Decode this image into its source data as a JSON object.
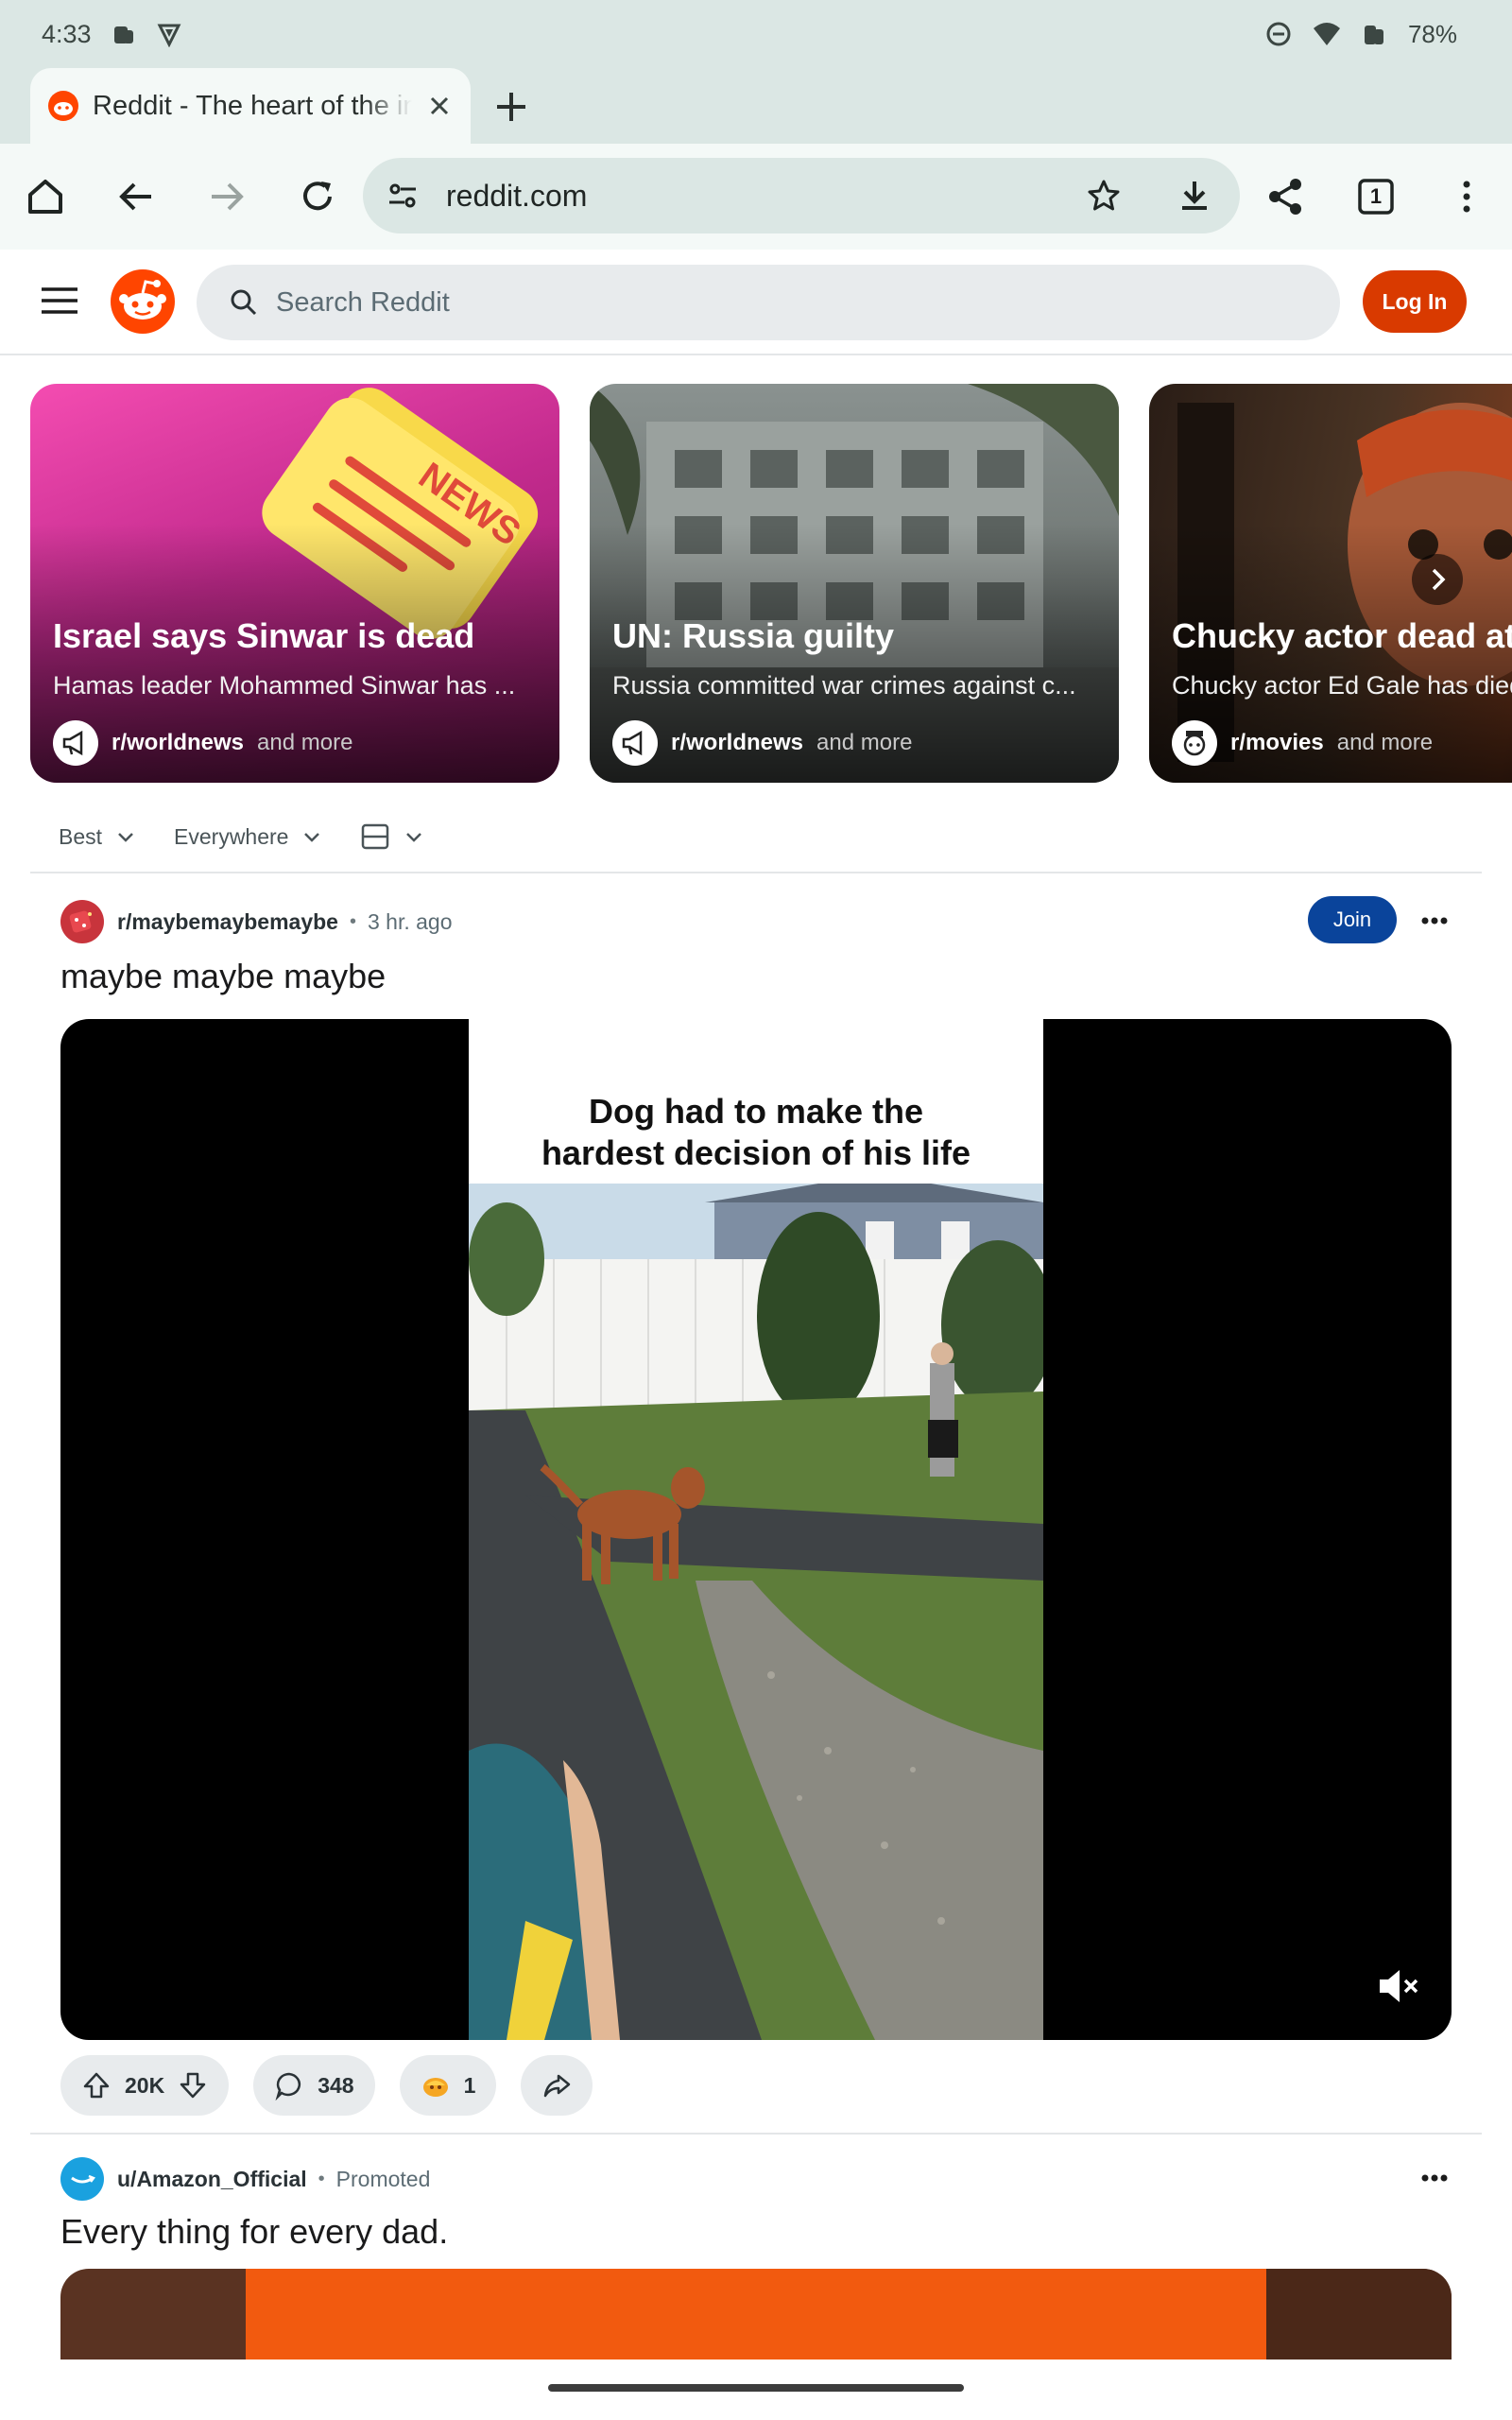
{
  "status_bar": {
    "time": "4:33",
    "battery": "78%"
  },
  "browser": {
    "tab_title": "Reddit - The heart of the internet",
    "url": "reddit.com",
    "tab_count": "1"
  },
  "reddit_header": {
    "search_placeholder": "Search Reddit",
    "login_label": "Log In"
  },
  "trending": [
    {
      "title": "Israel says Sinwar is dead",
      "description": "Hamas leader Mohammed Sinwar has ...",
      "subreddit": "r/worldnews",
      "more": "and more"
    },
    {
      "title": "UN: Russia guilty",
      "description": "Russia committed war crimes against c...",
      "subreddit": "r/worldnews",
      "more": "and more"
    },
    {
      "title": "Chucky actor dead at",
      "description": "Chucky actor Ed Gale has died",
      "subreddit": "r/movies",
      "more": "and more"
    }
  ],
  "sort_bar": {
    "sort": "Best",
    "scope": "Everywhere"
  },
  "post": {
    "subreddit": "r/maybemaybemaybe",
    "time": "3 hr. ago",
    "join_label": "Join",
    "title": "maybe maybe maybe",
    "video_caption_line1": "Dog had to make the",
    "video_caption_line2": "hardest decision of his life",
    "votes": "20K",
    "comments": "348",
    "awards": "1"
  },
  "ad": {
    "author": "u/Amazon_Official",
    "label": "Promoted",
    "title": "Every thing for every dad."
  },
  "colors": {
    "reddit_orange": "#d93a00",
    "join_blue": "#0a449b",
    "chrome_bg": "#dbe7e4"
  }
}
